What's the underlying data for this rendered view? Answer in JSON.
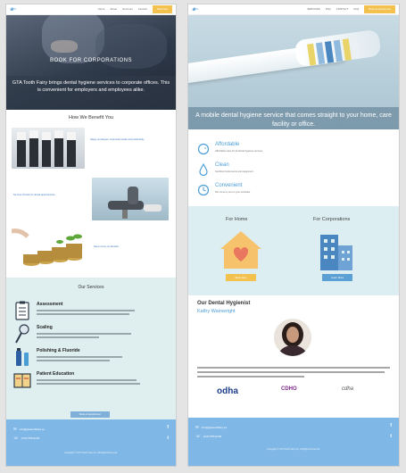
{
  "left_page": {
    "nav": {
      "logo_alt": "GTA Tooth Fairy",
      "links": [
        "Home",
        "About",
        "Services",
        "Contact"
      ],
      "cta": "Book Now"
    },
    "hero": {
      "title": "BOOK FOR CORPORATIONS",
      "text": "GTA Tooth Fairy brings dental hygiene services to corporate offices. This is convenient for employers and employees alike."
    },
    "benefits_title": "How We Benefit You",
    "benefits": [
      {
        "text": "Happy employees. Improved morale and productivity."
      },
      {
        "text": "No time off work for dental appointments."
      },
      {
        "text": "Save money on benefits."
      }
    ],
    "services_title": "Our Services",
    "services": [
      {
        "name": "Assessment"
      },
      {
        "name": "Scaling"
      },
      {
        "name": "Polishing & Fluoride"
      },
      {
        "name": "Patient Education"
      }
    ],
    "services_button": "Book an Appointment",
    "footer": {
      "email": "info@gtatoothfairy.ca",
      "phone": "(416) 555-0100",
      "copyright": "Copyright © GTA Tooth Fairy Inc. All Rights Reserved."
    }
  },
  "right_page": {
    "nav": {
      "logo_alt": "GTA Tooth Fairy",
      "links": [
        "SERVICES",
        "FAQ",
        "CONTACT",
        "FAQ"
      ],
      "cta": "Book an Appointment"
    },
    "hero": {
      "text": "A mobile dental hygiene service that comes straight to your home, care facility or office."
    },
    "features": [
      {
        "title": "Affordable",
        "desc": "Affordable rates for all dental hygiene services."
      },
      {
        "title": "Clean",
        "desc": "Sterilized instruments and equipment."
      },
      {
        "title": "Convenient",
        "desc": "We come to you on your schedule."
      }
    ],
    "care": {
      "home_title": "For Home",
      "home_button": "Book Now",
      "corp_title": "For Corporations",
      "corp_button": "Learn More"
    },
    "hygienist": {
      "title": "Our Dental Hygienist",
      "name": "Kathy Wainwright"
    },
    "partners": [
      "odha",
      "CDHO",
      "cdha"
    ],
    "footer": {
      "email": "info@gtatoothfairy.ca",
      "phone": "(416) 555-0100",
      "copyright": "Copyright © GTA Tooth Fairy Inc. All Rights Reserved."
    }
  },
  "colors": {
    "accent_blue": "#7fb7e6",
    "accent_yellow": "#f2c14e",
    "band_teal": "#dceef1",
    "link_blue": "#4a9ed6"
  }
}
